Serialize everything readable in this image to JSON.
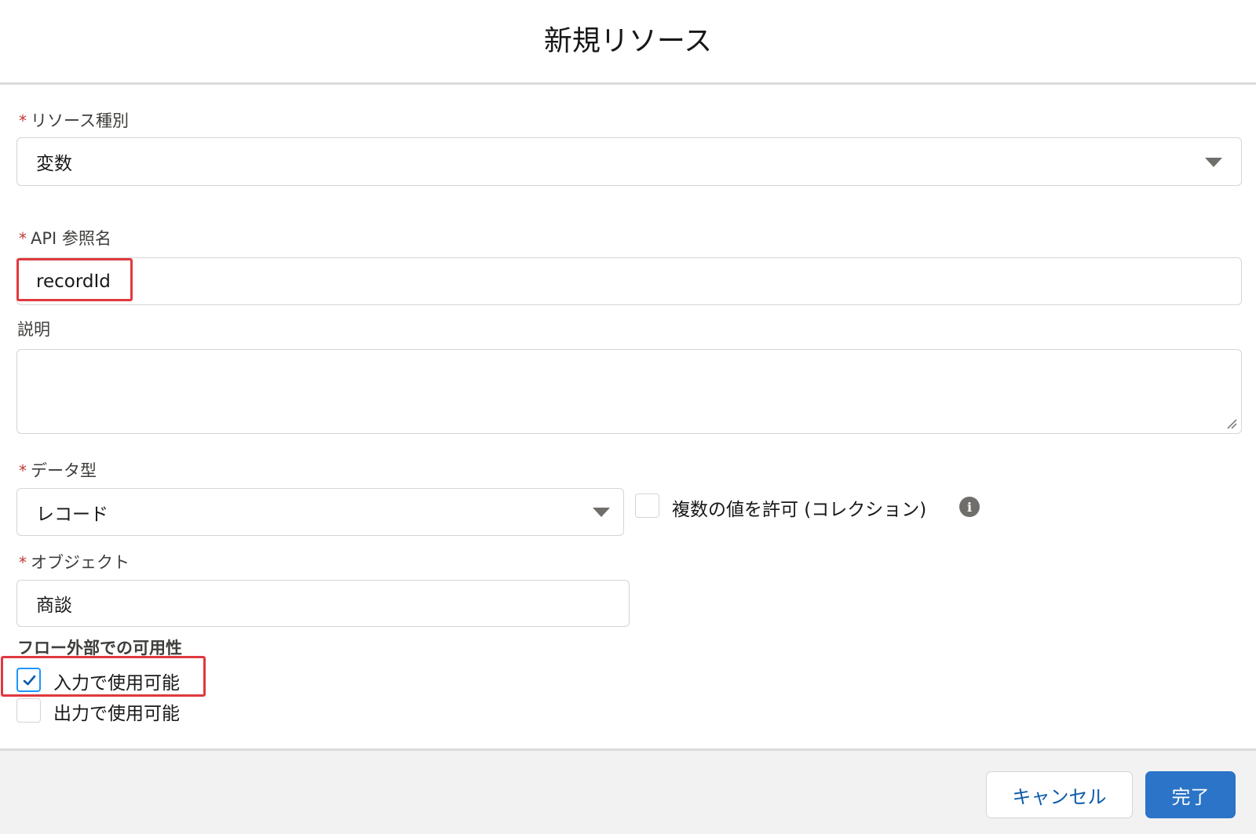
{
  "modal": {
    "title": "新規リソース"
  },
  "fields": {
    "resource_type": {
      "required_mark": "*",
      "label": "リソース種別",
      "value": "変数"
    },
    "api_name": {
      "required_mark": "*",
      "label": "API 参照名",
      "value": "recordId"
    },
    "description": {
      "label": "説明",
      "value": ""
    },
    "data_type": {
      "required_mark": "*",
      "label": "データ型",
      "value": "レコード"
    },
    "allow_multiple": {
      "label": "複数の値を許可 (コレクション)",
      "checked": false
    },
    "object": {
      "required_mark": "*",
      "label": "オブジェクト",
      "value": "商談"
    }
  },
  "availability": {
    "title": "フロー外部での可用性",
    "input": {
      "label": "入力で使用可能",
      "checked": true
    },
    "output": {
      "label": "出力で使用可能",
      "checked": false
    }
  },
  "footer": {
    "cancel_label": "キャンセル",
    "done_label": "完了"
  },
  "colors": {
    "required": "#c23934",
    "highlight": "#e0393e",
    "brand_button": "#2b74c7",
    "link_text": "#0b5cab",
    "checkbox_focus": "#1b96ff"
  },
  "icons": [
    "dropdown-caret-icon",
    "info-icon",
    "checkmark-icon",
    "resize-handle-icon"
  ]
}
